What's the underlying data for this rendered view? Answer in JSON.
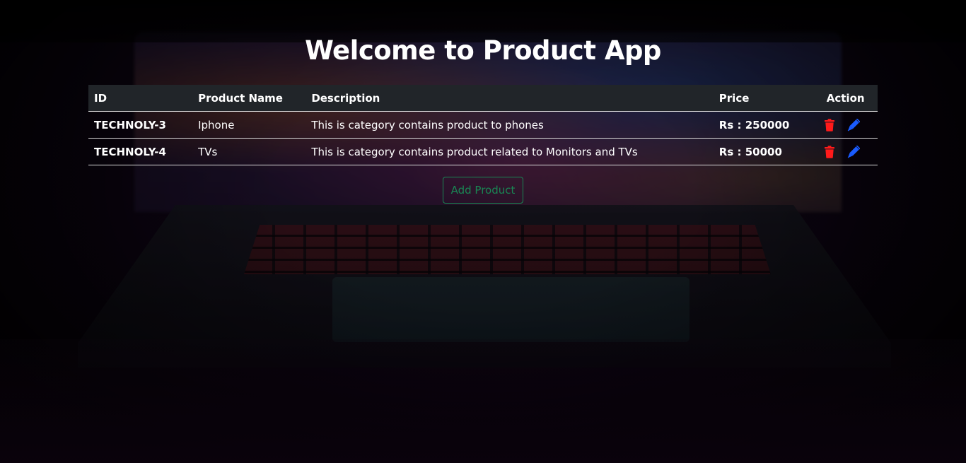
{
  "page": {
    "title": "Welcome to Product App"
  },
  "table": {
    "headers": {
      "id": "ID",
      "name": "Product Name",
      "description": "Description",
      "price": "Price",
      "action": "Action"
    },
    "rows": [
      {
        "id": "TECHNOLY-3",
        "name": "Iphone",
        "description": "This is category contains product to phones",
        "price": "Rs : 250000"
      },
      {
        "id": "TECHNOLY-4",
        "name": "TVs",
        "description": "This is category contains product related to Monitors and TVs",
        "price": "Rs : 50000"
      }
    ]
  },
  "buttons": {
    "add_product": "Add Product"
  },
  "icons": {
    "delete": "trash-icon",
    "edit": "pen-icon"
  },
  "colors": {
    "delete": "#ff1a1a",
    "edit": "#1a5cff",
    "add_button": "#198754",
    "table_header": "#212529"
  }
}
